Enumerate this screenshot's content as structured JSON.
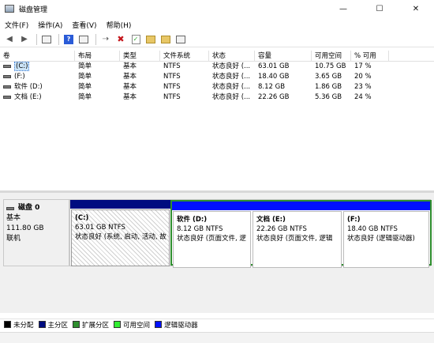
{
  "window": {
    "title": "磁盘管理",
    "minimize": "—",
    "maximize": "☐",
    "close": "✕"
  },
  "menu": [
    "文件(F)",
    "操作(A)",
    "查看(V)",
    "帮助(H)"
  ],
  "toolbar": {
    "icons": [
      "back-arrow-icon",
      "forward-arrow-icon",
      "console-tree-icon",
      "help-icon",
      "properties-icon",
      "connect-icon",
      "delete-icon",
      "check-icon",
      "folder-up-icon",
      "open-icon",
      "console-icon"
    ]
  },
  "volumes": {
    "headers": [
      "卷",
      "布局",
      "类型",
      "文件系统",
      "状态",
      "容量",
      "可用空间",
      "% 可用"
    ],
    "rows": [
      {
        "name": "(C:)",
        "layout": "简单",
        "type": "基本",
        "fs": "NTFS",
        "status": "状态良好 (...",
        "capacity": "63.01 GB",
        "free": "10.75 GB",
        "pct": "17 %"
      },
      {
        "name": "(F:)",
        "layout": "简单",
        "type": "基本",
        "fs": "NTFS",
        "status": "状态良好 (...",
        "capacity": "18.40 GB",
        "free": "3.65 GB",
        "pct": "20 %"
      },
      {
        "name": "软件 (D:)",
        "layout": "简单",
        "type": "基本",
        "fs": "NTFS",
        "status": "状态良好 (...",
        "capacity": "8.12 GB",
        "free": "1.86 GB",
        "pct": "23 %"
      },
      {
        "name": "文档 (E:)",
        "layout": "简单",
        "type": "基本",
        "fs": "NTFS",
        "status": "状态良好 (...",
        "capacity": "22.26 GB",
        "free": "5.36 GB",
        "pct": "24 %"
      }
    ]
  },
  "disk0": {
    "name": "磁盘 0",
    "type": "基本",
    "size": "111.80 GB",
    "state": "联机",
    "partitions": [
      {
        "name": "(C:)",
        "size": "63.01 GB NTFS",
        "status": "状态良好 (系统, 启动, 活动, 故",
        "kind": "primary"
      },
      {
        "name": "软件 (D:)",
        "size": "8.12 GB NTFS",
        "status": "状态良好 (页面文件, 逻",
        "kind": "logical"
      },
      {
        "name": "文档 (E:)",
        "size": "22.26 GB NTFS",
        "status": "状态良好 (页面文件, 逻辑",
        "kind": "logical"
      },
      {
        "name": "(F:)",
        "size": "18.40 GB NTFS",
        "status": "状态良好 (逻辑驱动器)",
        "kind": "logical"
      }
    ]
  },
  "legend": [
    {
      "label": "未分配",
      "color": "#000000"
    },
    {
      "label": "主分区",
      "color": "#000c80"
    },
    {
      "label": "扩展分区",
      "color": "#2f8f2f"
    },
    {
      "label": "可用空间",
      "color": "#33ee33"
    },
    {
      "label": "逻辑驱动器",
      "color": "#0010ff"
    }
  ]
}
